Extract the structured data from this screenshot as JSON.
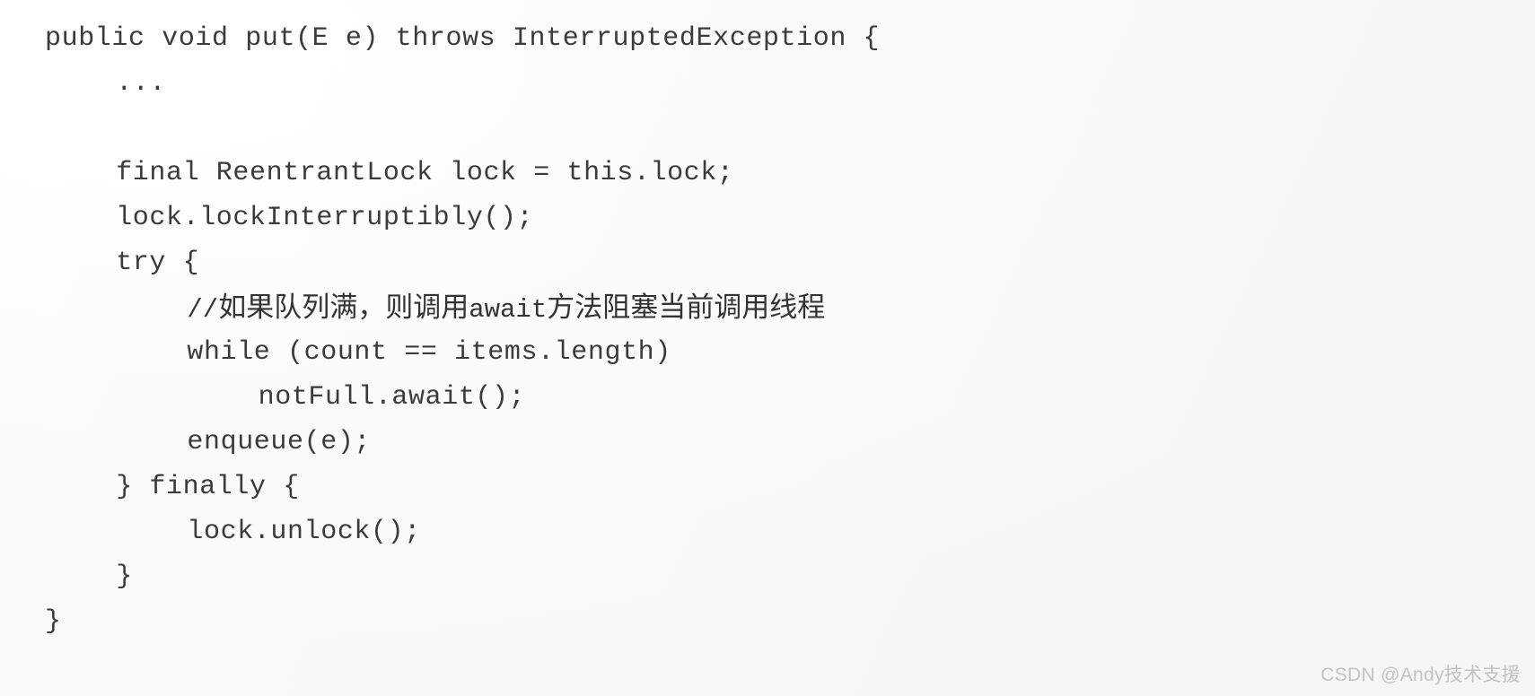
{
  "page": {
    "kind": "scanned-code-listing",
    "language": "Java",
    "background_color": "#fefefe",
    "text_color": "#3b3b3b"
  },
  "code": {
    "lines": [
      {
        "indent": 0,
        "text": "public void put(E e) throws InterruptedException {",
        "type": "code"
      },
      {
        "indent": 4,
        "text": "...",
        "type": "code"
      },
      {
        "indent": 0,
        "text": "",
        "type": "blank"
      },
      {
        "indent": 4,
        "text": "final ReentrantLock lock = this.lock;",
        "type": "code"
      },
      {
        "indent": 4,
        "text": "lock.lockInterruptibly();",
        "type": "code"
      },
      {
        "indent": 4,
        "text": "try {",
        "type": "code"
      },
      {
        "indent": 8,
        "text": "//如果队列满，则调用await方法阻塞当前调用线程",
        "type": "comment"
      },
      {
        "indent": 8,
        "text": "while (count == items.length)",
        "type": "code"
      },
      {
        "indent": 12,
        "text": "notFull.await();",
        "type": "code"
      },
      {
        "indent": 8,
        "text": "enqueue(e);",
        "type": "code"
      },
      {
        "indent": 4,
        "text": "} finally {",
        "type": "code"
      },
      {
        "indent": 8,
        "text": "lock.unlock();",
        "type": "code"
      },
      {
        "indent": 4,
        "text": "}",
        "type": "code"
      },
      {
        "indent": 0,
        "text": "}",
        "type": "code"
      }
    ]
  },
  "watermark": {
    "text": "CSDN @Andy技术支援",
    "color": "#c2c2c2"
  }
}
